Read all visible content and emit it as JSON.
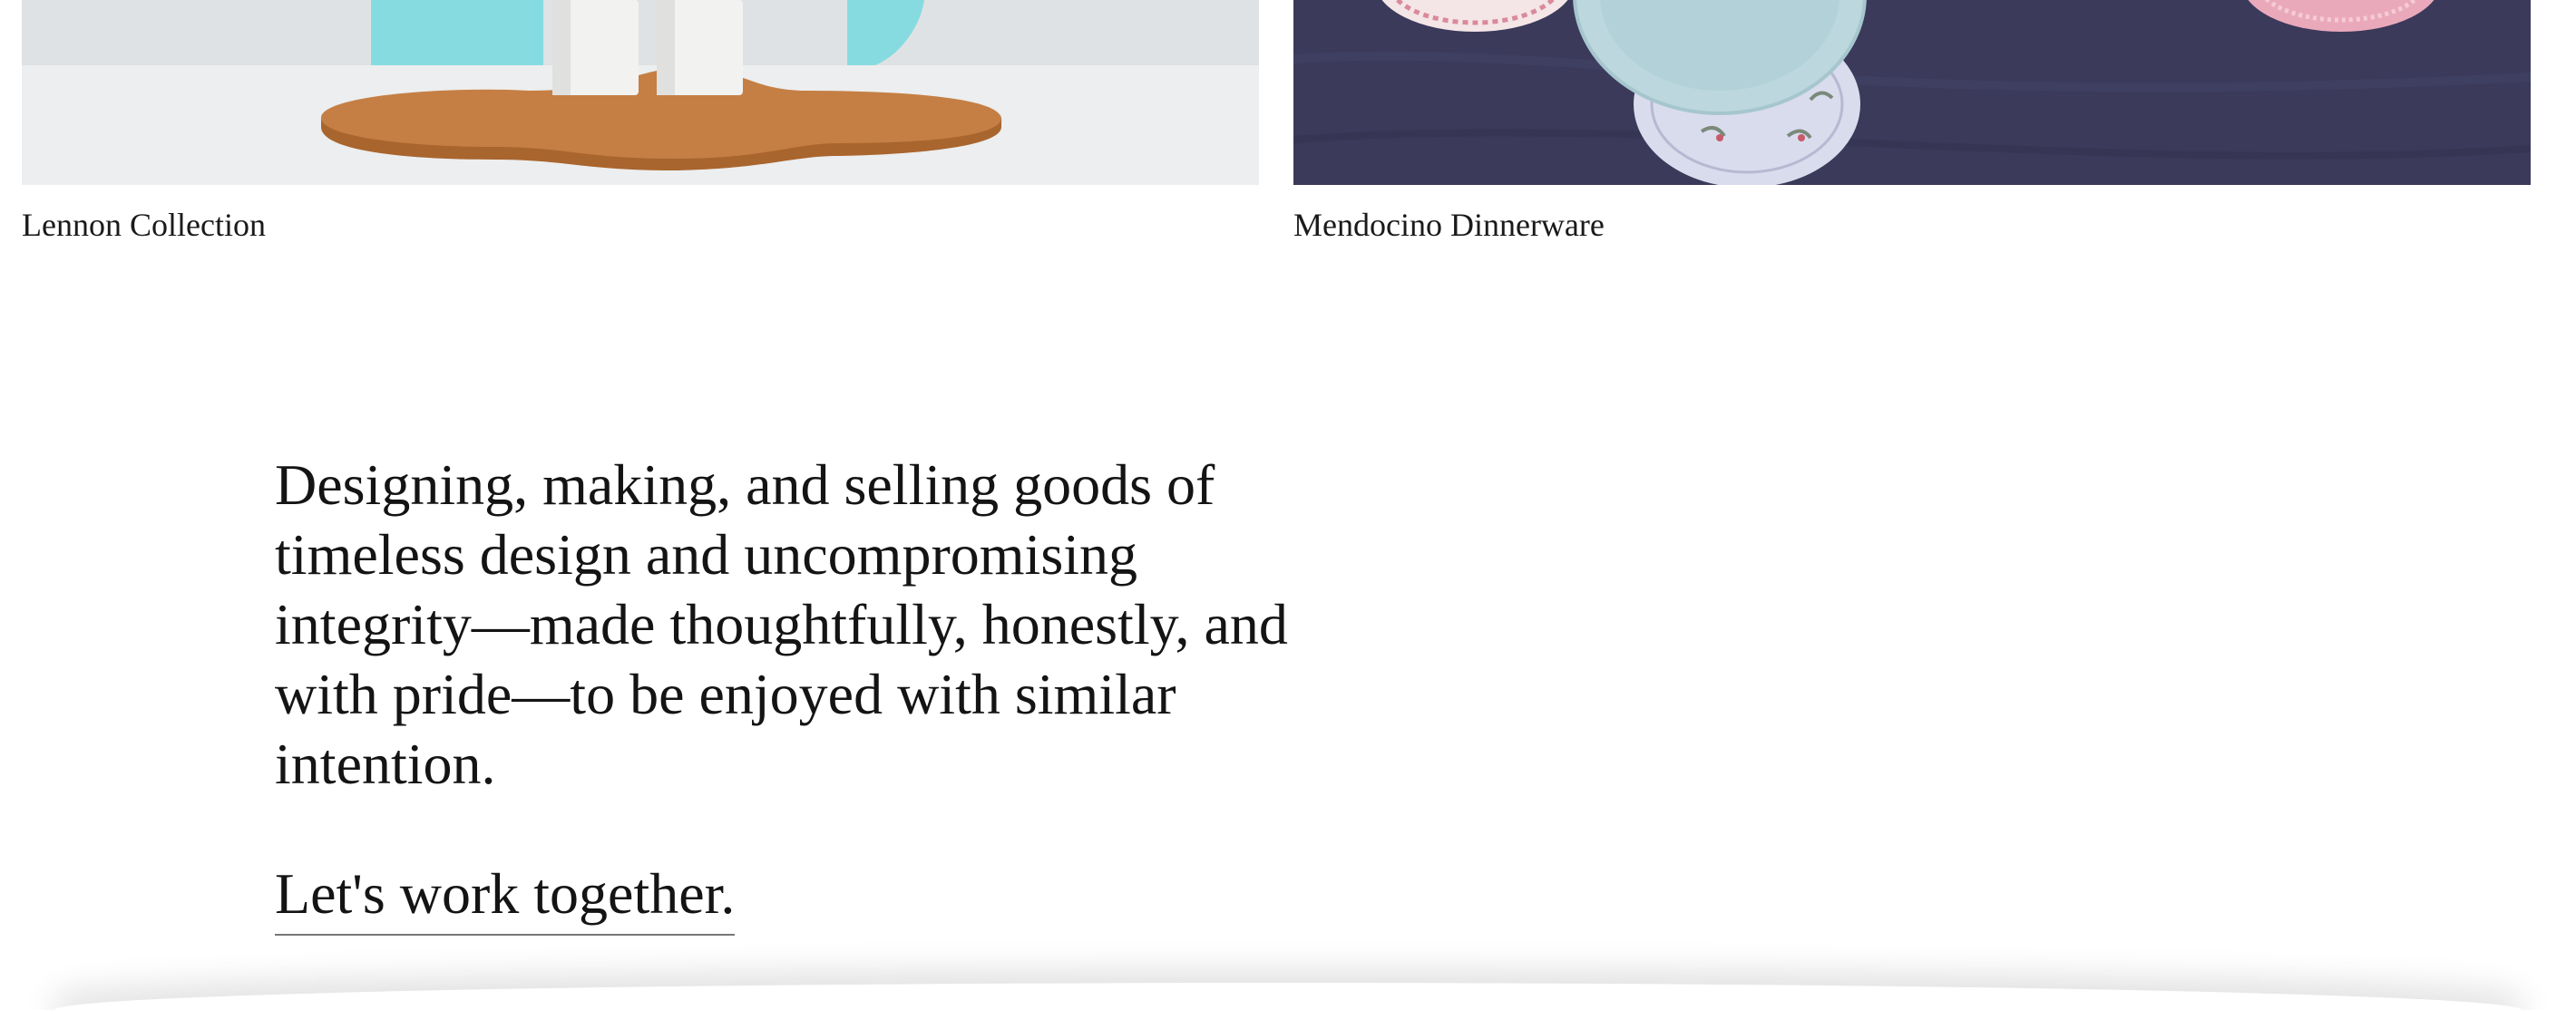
{
  "gallery": {
    "items": [
      {
        "caption": "Lennon Collection",
        "image": "salt-and-pepper-shakers-photo"
      },
      {
        "caption": "Mendocino Dinnerware",
        "image": "dinner-plates-photo"
      }
    ]
  },
  "intro": {
    "statement": "Designing, making, and selling goods of timeless design and uncompromising integrity—made thoughtfully, honestly, and with pride—to be enjoyed with similar intention.",
    "cta_label": "Let's work together."
  },
  "colors": {
    "text": "#141414",
    "table_surface": "#ededee",
    "chair_turquoise": "#86dbe0",
    "wood": "#c9854a",
    "slate_background": "#3b3a5a",
    "plate_blue": "#bcd7dd",
    "plate_pink": "#e6a7b8"
  }
}
